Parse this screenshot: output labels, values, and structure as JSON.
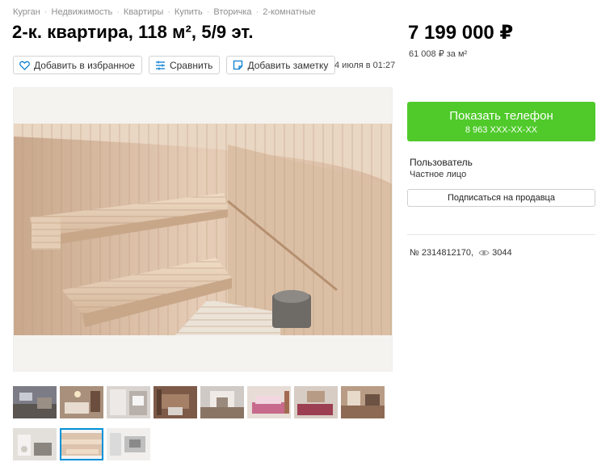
{
  "breadcrumbs": [
    "Курган",
    "Недвижимость",
    "Квартиры",
    "Купить",
    "Вторичка",
    "2-комнатные"
  ],
  "title": "2-к. квартира, 118 м², 5/9 эт.",
  "actions": {
    "favorite": "Добавить в избранное",
    "compare": "Сравнить",
    "note": "Добавить заметку"
  },
  "date": "4 июля в 01:27",
  "price": "7 199 000 ₽",
  "price_per_m2": "61 008 ₽ за м²",
  "phone": {
    "label": "Показать телефон",
    "number": "8 963 XXX-XX-XX"
  },
  "seller": {
    "name": "Пользователь",
    "type": "Частное лицо",
    "subscribe": "Подписаться на продавца"
  },
  "item": {
    "number": "№ 2314812170,",
    "views": "3044"
  },
  "colors": {
    "accent_green": "#4fca2a",
    "thumb_active": "#0091d9"
  },
  "gallery": {
    "main_photo": "sauna-interior",
    "thumbnails": [
      "living-room",
      "bedroom",
      "bathroom",
      "hallway",
      "kitchen",
      "bedroom-pink",
      "bedroom-2",
      "living-room-2",
      "bathroom-2",
      "sauna",
      "shower"
    ],
    "active_index": 9
  }
}
